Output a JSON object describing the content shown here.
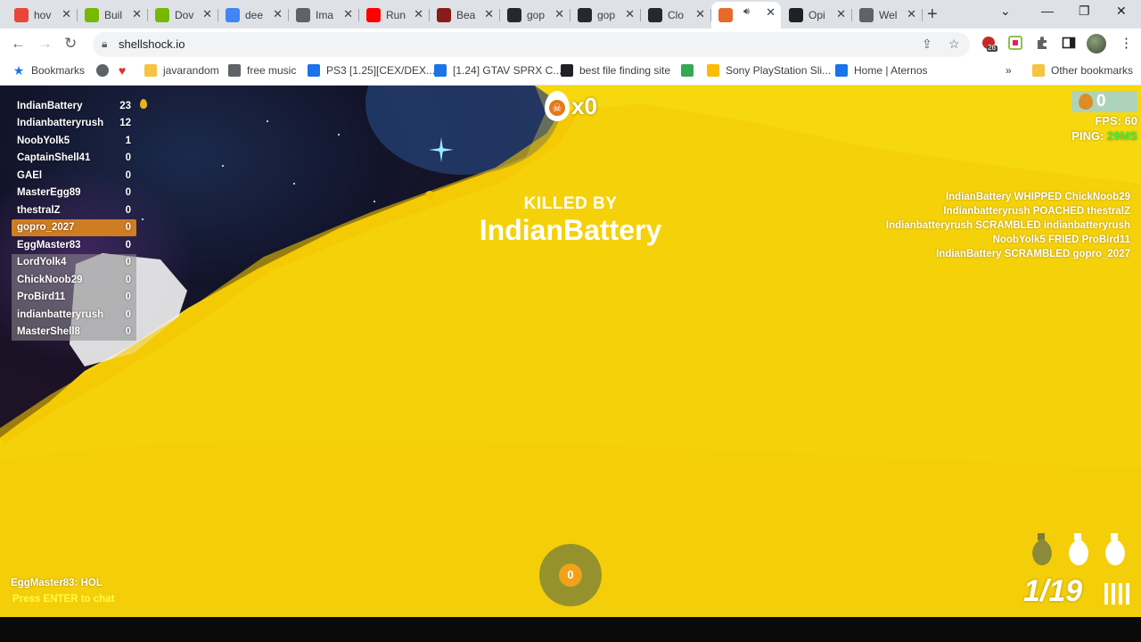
{
  "browser": {
    "tabs": [
      {
        "label": "hov",
        "icon": "red-flag-icon",
        "color": "#e8453c"
      },
      {
        "label": "Buil",
        "icon": "nvidia-icon",
        "color": "#76b900"
      },
      {
        "label": "Dov",
        "icon": "nvidia-icon",
        "color": "#76b900"
      },
      {
        "label": "dee",
        "icon": "google-icon",
        "color": "#4285f4"
      },
      {
        "label": "Ima",
        "icon": "chart-icon",
        "color": "#5f6368"
      },
      {
        "label": "Run",
        "icon": "youtube-icon",
        "color": "#ff0000"
      },
      {
        "label": "Bea",
        "icon": "m-icon",
        "color": "#8b1a1a"
      },
      {
        "label": "gop",
        "icon": "github-icon",
        "color": "#24292e"
      },
      {
        "label": "gop",
        "icon": "github-icon",
        "color": "#24292e"
      },
      {
        "label": "Clo",
        "icon": "github-icon",
        "color": "#24292e"
      },
      {
        "label": "",
        "icon": "shellshock-icon",
        "color": "#e8692b",
        "active": true
      },
      {
        "label": "Opi",
        "icon": "openai-icon",
        "color": "#202124"
      },
      {
        "label": "Wel",
        "icon": "globe-icon",
        "color": "#5f6368"
      }
    ],
    "url": "shellshock.io",
    "extension_badge": "26",
    "bookmarks": [
      {
        "label": "Bookmarks",
        "icon": "star-icon"
      },
      {
        "label": "",
        "icon": "globe-icon"
      },
      {
        "label": "",
        "icon": "heart-icon"
      },
      {
        "label": "javarandom",
        "icon": "folder-icon"
      },
      {
        "label": "free music",
        "icon": "alien-icon"
      },
      {
        "label": "PS3 [1.25][CEX/DEX...",
        "icon": "e-icon"
      },
      {
        "label": "[1.24] GTAV SPRX C...",
        "icon": "e-icon"
      },
      {
        "label": "best file finding site",
        "icon": "robot-icon"
      },
      {
        "label": "",
        "icon": "app-icon"
      },
      {
        "label": "Sony PlayStation Sli...",
        "icon": "shop-icon"
      },
      {
        "label": "Home | Aternos",
        "icon": "aternos-icon"
      }
    ],
    "other_bookmarks": "Other bookmarks",
    "more": "»"
  },
  "game": {
    "scoreboard": [
      {
        "name": "IndianBattery",
        "score": "23"
      },
      {
        "name": "Indianbatteryrush",
        "score": "12"
      },
      {
        "name": "NoobYolk5",
        "score": "1"
      },
      {
        "name": "CaptainShell41",
        "score": "0"
      },
      {
        "name": "GAEl",
        "score": "0"
      },
      {
        "name": "MasterEgg89",
        "score": "0"
      },
      {
        "name": "thestralZ",
        "score": "0"
      },
      {
        "name": "gopro_2027",
        "score": "0",
        "me": true
      },
      {
        "name": "EggMaster83",
        "score": "0"
      },
      {
        "name": "LordYolk4",
        "score": "0",
        "dim": true
      },
      {
        "name": "ChickNoob29",
        "score": "0",
        "dim": true
      },
      {
        "name": "ProBird11",
        "score": "0",
        "dim": true
      },
      {
        "name": "indianbatteryrush",
        "score": "0",
        "dim": true
      },
      {
        "name": "MasterShell8",
        "score": "0",
        "dim": true
      }
    ],
    "kills": "x0",
    "eggs": "0",
    "fps_label": "FPS: 60",
    "ping_label": "PING: ",
    "ping_value": "29MS",
    "killed_by_label": "KILLED BY",
    "killed_by_name": "IndianBattery",
    "kill_feed": [
      "IndianBattery WHIPPED ChickNoob29",
      "Indianbatteryrush POACHED thestralZ",
      "Indianbatteryrush SCRAMBLED indianbatteryrush",
      "NoobYolk5 FRIED ProBird11",
      "IndianBattery SCRAMBLED gopro_2027"
    ],
    "chat_message": "EggMaster83: HOL",
    "chat_hint": "Press ENTER to chat",
    "ability_value": "0",
    "ammo": "1/19",
    "colors": {
      "yolk": "#f5d10a",
      "me_row": "#cf7d22",
      "ping_ok": "#3cf03c"
    }
  }
}
